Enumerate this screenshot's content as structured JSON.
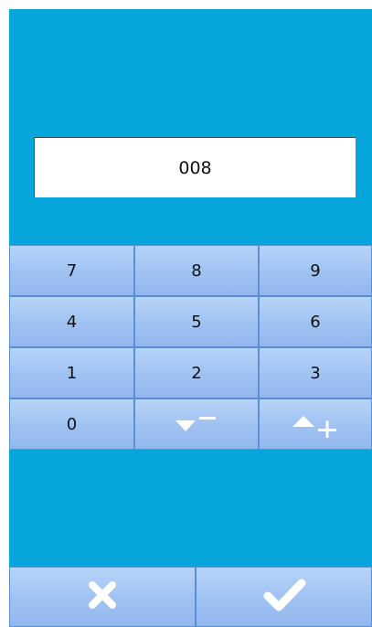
{
  "display": {
    "value": "008"
  },
  "keypad": {
    "keys": [
      "7",
      "8",
      "9",
      "4",
      "5",
      "6",
      "1",
      "2",
      "3",
      "0"
    ]
  },
  "icons": {
    "decrement": "decrement-minus-icon",
    "increment": "increment-plus-icon",
    "cancel": "close-x-icon",
    "confirm": "checkmark-icon"
  },
  "colors": {
    "background": "#06a6dd",
    "key_top": "#b7d4f8",
    "key_bottom": "#92b7ee",
    "icon": "#ffffff"
  }
}
